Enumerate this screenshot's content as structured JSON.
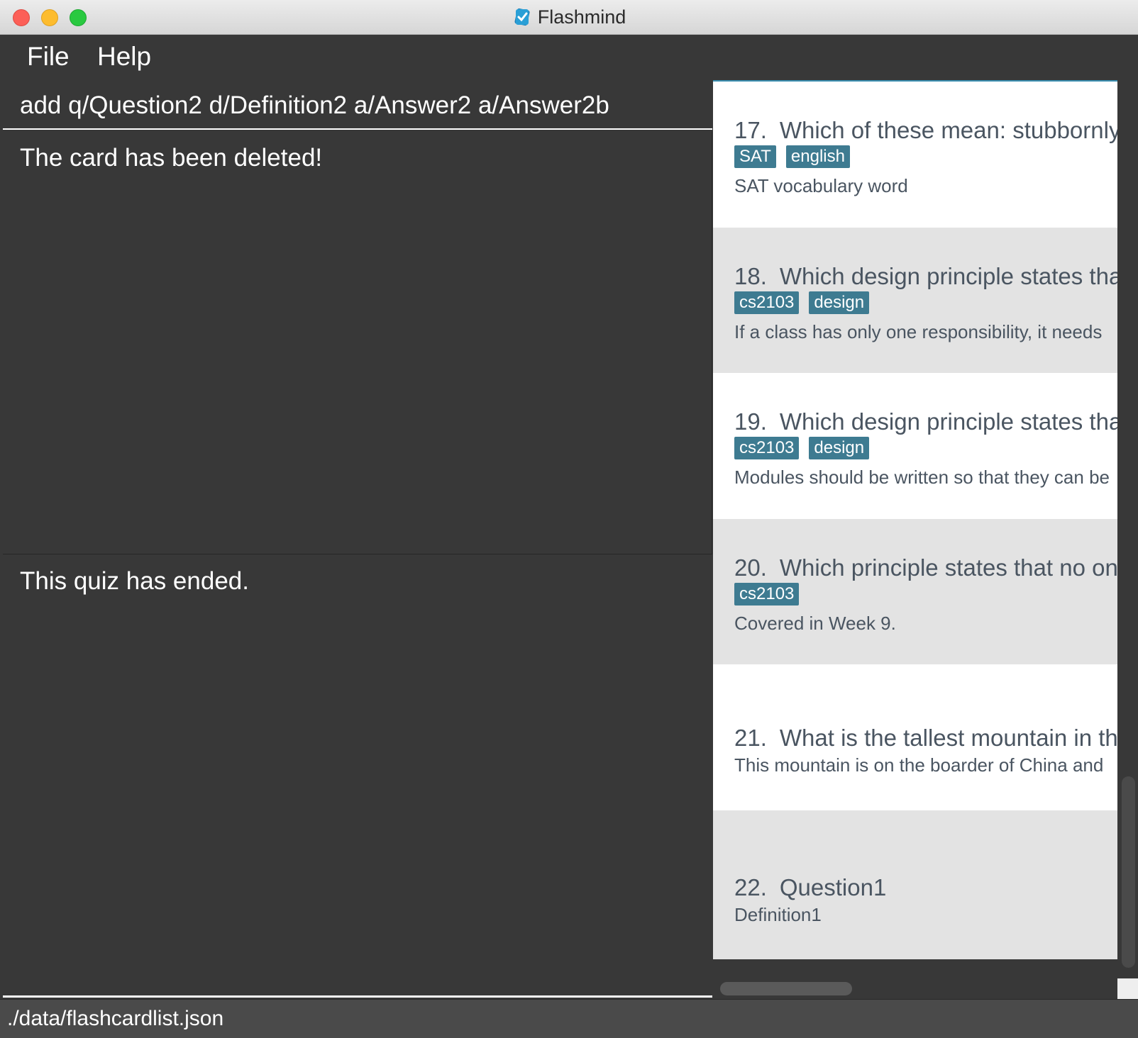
{
  "window": {
    "title": "Flashmind"
  },
  "menu": {
    "file": "File",
    "help": "Help"
  },
  "command": {
    "value": "add q/Question2 d/Definition2 a/Answer2 a/Answer2b"
  },
  "result": {
    "text": "The card has been deleted!"
  },
  "quiz": {
    "text": "This quiz has ended."
  },
  "cards": [
    {
      "index": "17.",
      "question": "Which of these mean: stubbornly unwilling",
      "tags": [
        "SAT",
        "english"
      ],
      "description": "SAT vocabulary word",
      "shade": "white"
    },
    {
      "index": "18.",
      "question": "Which design principle states that",
      "tags": [
        "cs2103",
        "design"
      ],
      "description": "If a class has only one responsibility, it needs",
      "shade": "grey"
    },
    {
      "index": "19.",
      "question": "Which design principle states that",
      "tags": [
        "cs2103",
        "design"
      ],
      "description": "Modules should be written so that they can be",
      "shade": "white"
    },
    {
      "index": "20.",
      "question": "Which principle states that no one",
      "tags": [
        "cs2103"
      ],
      "description": "Covered in Week 9.",
      "shade": "grey"
    },
    {
      "index": "21.",
      "question": "What is the tallest mountain in the",
      "tags": [],
      "description": "This mountain is on the boarder of China and",
      "shade": "white"
    },
    {
      "index": "22.",
      "question": "Question1",
      "tags": [],
      "description": "Definition1",
      "shade": "grey"
    }
  ],
  "status": {
    "path": "./data/flashcardlist.json"
  },
  "colors": {
    "background": "#383838",
    "tag": "#3e7b91",
    "card_grey": "#e3e3e3",
    "card_white": "#ffffff"
  }
}
